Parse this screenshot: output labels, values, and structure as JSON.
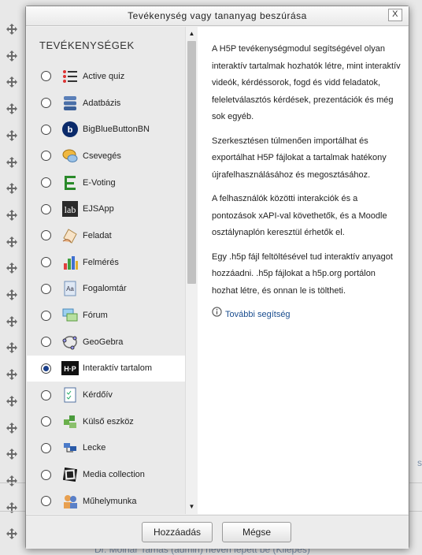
{
  "dialog": {
    "title": "Tevékenység vagy tananyag beszúrása",
    "close_label": "X",
    "section_title": "TEVÉKENYSÉGEK"
  },
  "options": [
    {
      "label": "Active quiz",
      "icon": "active-quiz-icon",
      "selected": false
    },
    {
      "label": "Adatbázis",
      "icon": "database-icon",
      "selected": false
    },
    {
      "label": "BigBlueButtonBN",
      "icon": "bigbluebutton-icon",
      "selected": false
    },
    {
      "label": "Csevegés",
      "icon": "chat-icon",
      "selected": false
    },
    {
      "label": "E-Voting",
      "icon": "evoting-icon",
      "selected": false
    },
    {
      "label": "EJSApp",
      "icon": "ejsapp-icon",
      "selected": false
    },
    {
      "label": "Feladat",
      "icon": "assignment-icon",
      "selected": false
    },
    {
      "label": "Felmérés",
      "icon": "survey-icon",
      "selected": false
    },
    {
      "label": "Fogalomtár",
      "icon": "glossary-icon",
      "selected": false
    },
    {
      "label": "Fórum",
      "icon": "forum-icon",
      "selected": false
    },
    {
      "label": "GeoGebra",
      "icon": "geogebra-icon",
      "selected": false
    },
    {
      "label": "Interaktív tartalom",
      "icon": "h5p-icon",
      "selected": true
    },
    {
      "label": "Kérdőív",
      "icon": "questionnaire-icon",
      "selected": false
    },
    {
      "label": "Külső eszköz",
      "icon": "external-tool-icon",
      "selected": false
    },
    {
      "label": "Lecke",
      "icon": "lesson-icon",
      "selected": false
    },
    {
      "label": "Media collection",
      "icon": "media-collection-icon",
      "selected": false
    },
    {
      "label": "Műhelymunka",
      "icon": "workshop-icon",
      "selected": false
    },
    {
      "label": "",
      "icon": "next-item-icon",
      "selected": false
    }
  ],
  "help": {
    "paragraphs": [
      "A H5P tevékenységmodul segítségével olyan interaktív tartalmak hozhatók létre, mint interaktív videók, kérdéssorok, fogd és vidd feladatok, feleletválasztós kérdések, prezentációk és még sok egyéb.",
      "Szerkesztésen túlmenően importálhat és exportálhat H5P fájlokat a tartalmak hatékony újrafelhasználásához és megosztásához.",
      "A felhasználók közötti interakciók és a pontozások xAPI-val követhetők, és a Moodle osztálynaplón keresztül érhetők el.",
      "Egy .h5p fájl feltöltésével tud interaktív anyagot hozzáadni. .h5p fájlokat a h5p.org portálon hozhat létre, és onnan le is töltheti."
    ],
    "more_help": "További segítség"
  },
  "buttons": {
    "add": "Hozzáadás",
    "cancel": "Mégse"
  },
  "background": {
    "footer_text": "Dr. Molnár Tamás (admin) néven lépett be (Kilépés)",
    "partial_text": "s"
  },
  "scroll": {
    "up": "▲",
    "down": "▼"
  }
}
